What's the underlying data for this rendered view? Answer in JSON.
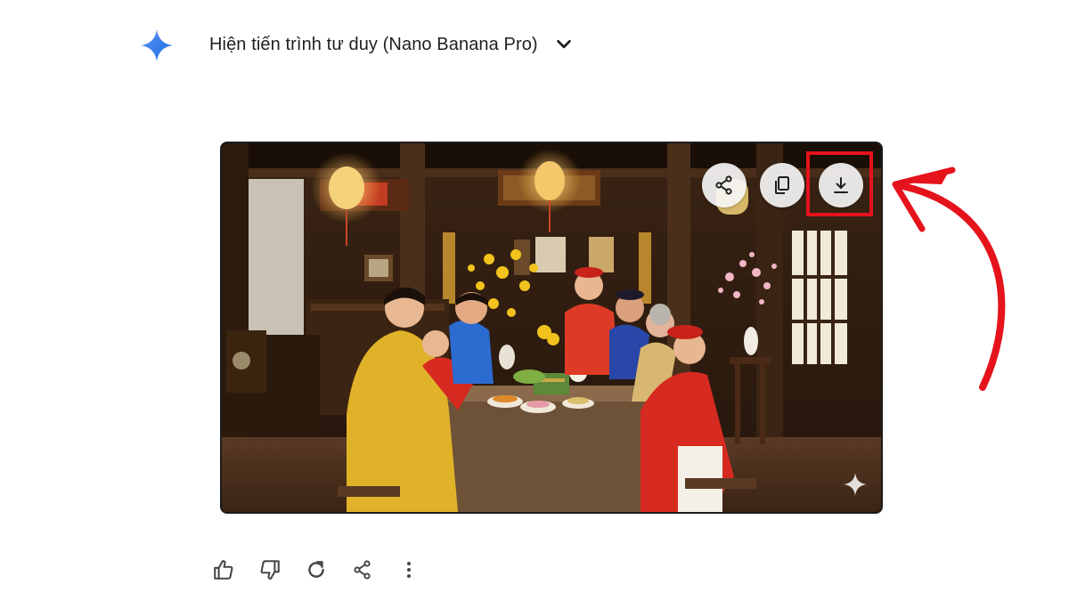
{
  "header": {
    "title": "Hiện tiến trình tư duy (Nano Banana Pro)",
    "gemini_icon": "gemini-sparkle-icon",
    "toggle_icon": "chevron-down-icon"
  },
  "image": {
    "image_actions": [
      {
        "name": "share",
        "icon": "share-icon"
      },
      {
        "name": "copy",
        "icon": "copy-icon"
      },
      {
        "name": "download",
        "icon": "download-icon"
      }
    ],
    "watermark_icon": "sparkle-icon"
  },
  "annotation": {
    "highlight_color": "#e5131b",
    "arrow_color": "#e5131b"
  },
  "response_actions": [
    {
      "name": "good-response",
      "icon": "thumbs-up-icon"
    },
    {
      "name": "bad-response",
      "icon": "thumbs-down-icon"
    },
    {
      "name": "regenerate",
      "icon": "refresh-icon"
    },
    {
      "name": "share",
      "icon": "share-icon"
    },
    {
      "name": "more-options",
      "icon": "more-vert-icon"
    }
  ],
  "colors": {
    "gemini_blue": "#4285f4",
    "icon_gray": "#444746",
    "text": "#1f1f1f"
  }
}
